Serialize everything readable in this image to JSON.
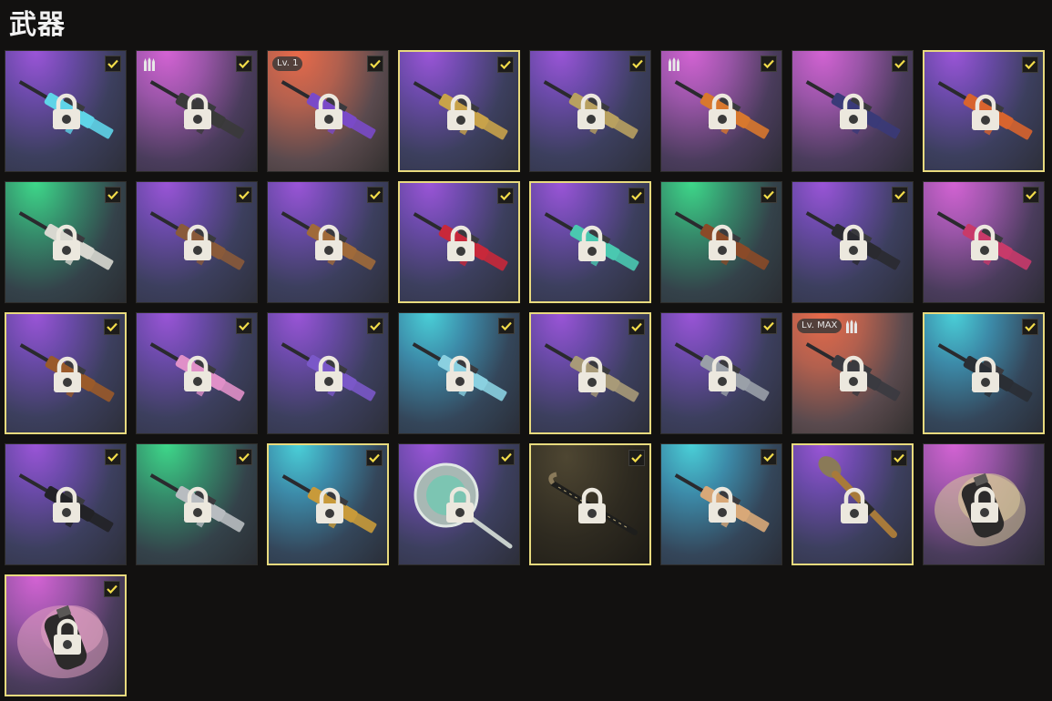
{
  "header": {
    "title": "武器"
  },
  "colors": {
    "selected_border": "#e8da7e",
    "check_mark": "#f2dc4a",
    "page_background": "#121110"
  },
  "items": [
    {
      "name": "weapon-assault-rifle-cyan",
      "bg": "purple",
      "selected": false,
      "checked": true,
      "level": "",
      "ammo": false,
      "accent": "#5fd4e8"
    },
    {
      "name": "weapon-assault-rifle-dark",
      "bg": "pink",
      "selected": false,
      "checked": true,
      "level": "",
      "ammo": true,
      "accent": "#3a3a3a"
    },
    {
      "name": "weapon-rifle-violet",
      "bg": "orange",
      "selected": false,
      "checked": true,
      "level": "Lv. 1",
      "ammo": false,
      "accent": "#7a4ac8"
    },
    {
      "name": "weapon-rifle-gold",
      "bg": "purple",
      "selected": true,
      "checked": true,
      "level": "",
      "ammo": false,
      "accent": "#c8a24a"
    },
    {
      "name": "weapon-rifle-gold-camo",
      "bg": "purple",
      "selected": false,
      "checked": true,
      "level": "",
      "ammo": false,
      "accent": "#b8a060"
    },
    {
      "name": "weapon-ak-orange",
      "bg": "pink",
      "selected": false,
      "checked": true,
      "level": "",
      "ammo": true,
      "accent": "#d8782e"
    },
    {
      "name": "weapon-rifle-navy",
      "bg": "pink",
      "selected": false,
      "checked": true,
      "level": "",
      "ammo": false,
      "accent": "#3a3a78"
    },
    {
      "name": "weapon-rifle-orange",
      "bg": "purple",
      "selected": true,
      "checked": true,
      "level": "",
      "ammo": false,
      "accent": "#d8642e"
    },
    {
      "name": "weapon-sniper-white",
      "bg": "green",
      "selected": false,
      "checked": true,
      "level": "",
      "ammo": false,
      "accent": "#d8d8d0"
    },
    {
      "name": "weapon-ak-brown",
      "bg": "purple",
      "selected": false,
      "checked": true,
      "level": "",
      "ammo": false,
      "accent": "#8a5a3a"
    },
    {
      "name": "weapon-ak-wood",
      "bg": "purple",
      "selected": false,
      "checked": true,
      "level": "",
      "ammo": false,
      "accent": "#a06a3a"
    },
    {
      "name": "weapon-rifle-red",
      "bg": "purple",
      "selected": true,
      "checked": true,
      "level": "",
      "ammo": false,
      "accent": "#c8283a"
    },
    {
      "name": "weapon-rifle-teal-pattern",
      "bg": "purple",
      "selected": true,
      "checked": true,
      "level": "",
      "ammo": false,
      "accent": "#4ac8b0"
    },
    {
      "name": "weapon-rifle-wood-long",
      "bg": "green",
      "selected": false,
      "checked": true,
      "level": "",
      "ammo": false,
      "accent": "#8a4a28"
    },
    {
      "name": "weapon-sniper-black",
      "bg": "purple",
      "selected": false,
      "checked": true,
      "level": "",
      "ammo": false,
      "accent": "#2a2a30"
    },
    {
      "name": "weapon-rifle-pink-black",
      "bg": "pink",
      "selected": false,
      "checked": true,
      "level": "",
      "ammo": false,
      "accent": "#c83a6a"
    },
    {
      "name": "weapon-sniper-wood",
      "bg": "purple",
      "selected": true,
      "checked": true,
      "level": "",
      "ammo": false,
      "accent": "#9a5a2a"
    },
    {
      "name": "weapon-smg-pink",
      "bg": "purple",
      "selected": false,
      "checked": true,
      "level": "",
      "ammo": false,
      "accent": "#e090c8"
    },
    {
      "name": "weapon-smg-galaxy",
      "bg": "purple",
      "selected": false,
      "checked": true,
      "level": "",
      "ammo": false,
      "accent": "#7a58c8"
    },
    {
      "name": "weapon-smg-suppressed",
      "bg": "blue",
      "selected": false,
      "checked": true,
      "level": "",
      "ammo": false,
      "accent": "#8ad0e0"
    },
    {
      "name": "weapon-smg-sand",
      "bg": "purple",
      "selected": true,
      "checked": true,
      "level": "",
      "ammo": false,
      "accent": "#a89a78"
    },
    {
      "name": "weapon-smg-steel",
      "bg": "purple",
      "selected": false,
      "checked": true,
      "level": "",
      "ammo": false,
      "accent": "#9aa0a8"
    },
    {
      "name": "weapon-smg-compact",
      "bg": "orange",
      "selected": false,
      "checked": false,
      "level": "Lv. MAX",
      "ammo": true,
      "accent": "#3a3a40"
    },
    {
      "name": "weapon-rifle-stealth",
      "bg": "blue",
      "selected": true,
      "checked": true,
      "level": "",
      "ammo": false,
      "accent": "#2a2e34"
    },
    {
      "name": "weapon-shotgun-black",
      "bg": "purple",
      "selected": false,
      "checked": true,
      "level": "",
      "ammo": false,
      "accent": "#222226"
    },
    {
      "name": "weapon-shotgun-silver",
      "bg": "green",
      "selected": false,
      "checked": true,
      "level": "",
      "ammo": false,
      "accent": "#b8bcc0"
    },
    {
      "name": "weapon-shotgun-gold",
      "bg": "blue",
      "selected": true,
      "checked": true,
      "level": "",
      "ammo": false,
      "accent": "#c89a3a"
    },
    {
      "name": "weapon-pan",
      "bg": "purple",
      "selected": false,
      "checked": true,
      "level": "",
      "ammo": false,
      "accent": "#b8c8c0"
    },
    {
      "name": "weapon-crowbar",
      "bg": "dark",
      "selected": true,
      "checked": true,
      "level": "",
      "ammo": false,
      "accent": "#3a3a36"
    },
    {
      "name": "weapon-crossbow",
      "bg": "blue",
      "selected": false,
      "checked": true,
      "level": "",
      "ammo": false,
      "accent": "#d8a878"
    },
    {
      "name": "weapon-rocket-launcher",
      "bg": "purple",
      "selected": true,
      "checked": true,
      "level": "",
      "ammo": false,
      "accent": "#a87a3a"
    },
    {
      "name": "throwable-smoke-yellow",
      "bg": "pink",
      "selected": false,
      "checked": false,
      "level": "",
      "ammo": false,
      "accent": "#d8c89a"
    },
    {
      "name": "throwable-smoke-pink",
      "bg": "pink",
      "selected": true,
      "checked": true,
      "level": "",
      "ammo": false,
      "accent": "#e0a0c0"
    }
  ]
}
